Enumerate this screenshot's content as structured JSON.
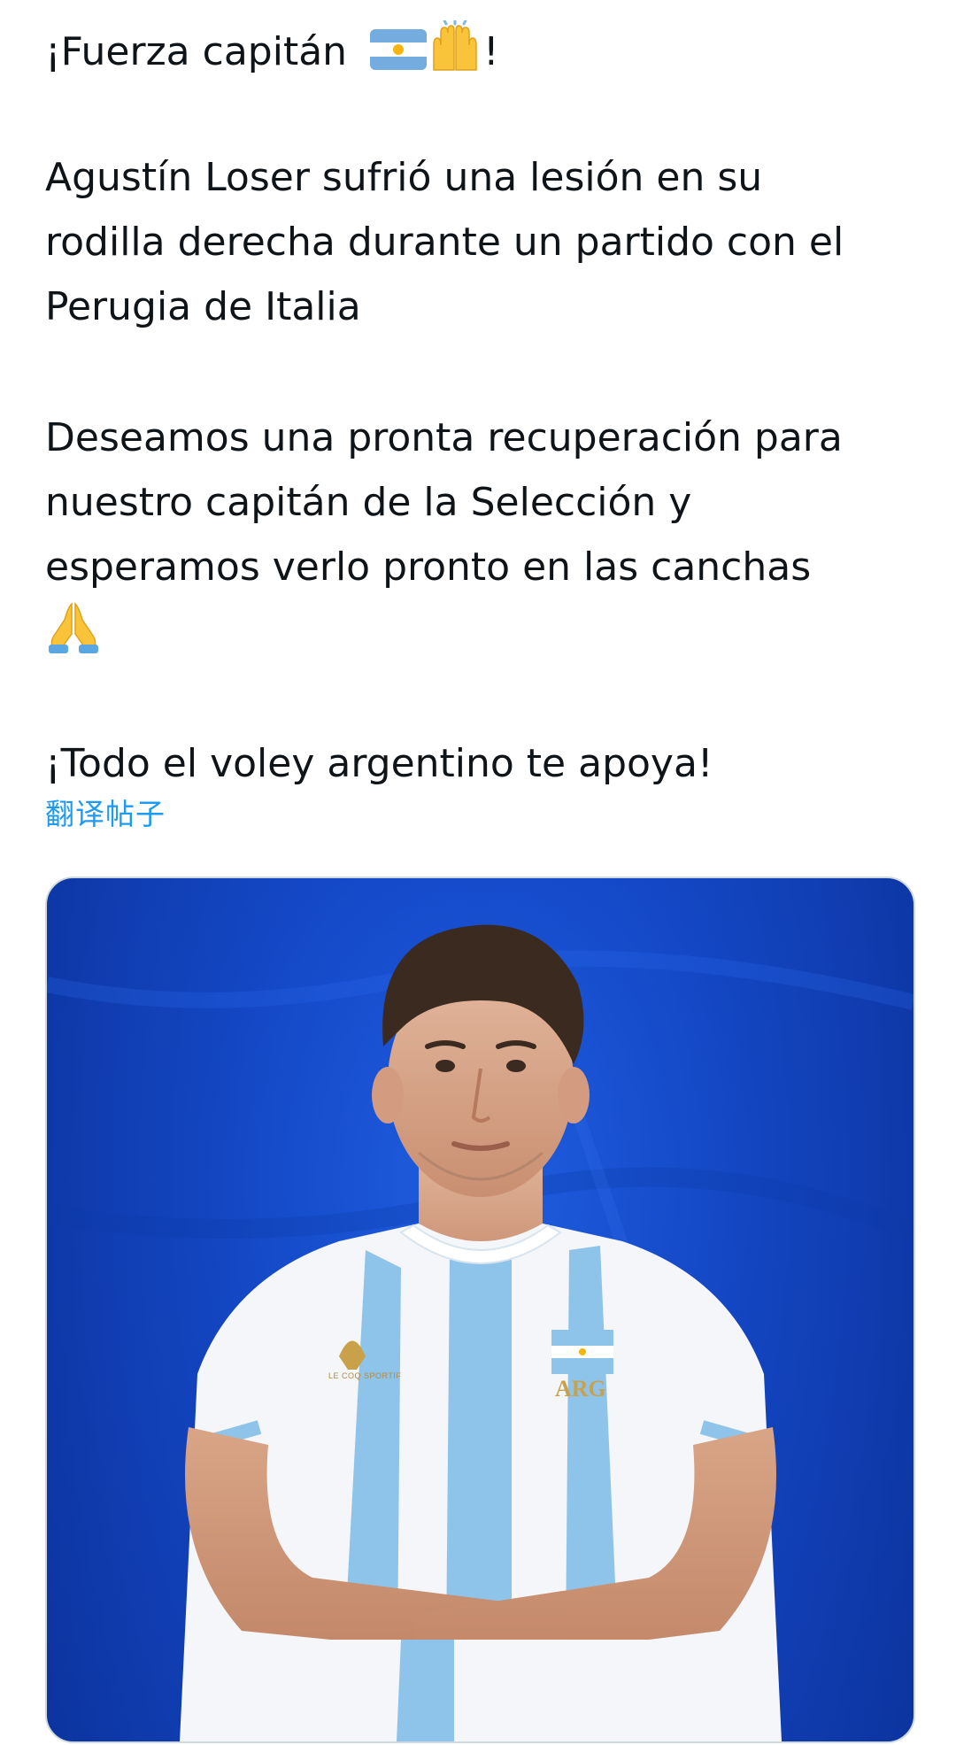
{
  "tweet": {
    "line1_text": "¡Fuerza capitán ",
    "line1_end": "!",
    "para2": "Agustín Loser sufrió una lesión en su\nrodilla derecha durante un partido con el\nPerugia de Italia",
    "para3": "Deseamos una pronta recuperación para\nnuestro capitán de la Selección y\nesperamos verlo pronto en las canchas",
    "para4": "¡Todo el voley argentino te apoya!",
    "translate_label": "翻译帖子",
    "emojis": [
      "argentina-flag",
      "raising-hands",
      "folded-hands"
    ]
  },
  "media": {
    "jersey_text": "ARG",
    "brand_text": "LE COQ SPORTIF"
  },
  "colors": {
    "text": "#0f1419",
    "link": "#1d9bf0",
    "media_bg": "#1448c8",
    "argentina_blue": "#74acdf",
    "sun": "#f6b40e"
  }
}
